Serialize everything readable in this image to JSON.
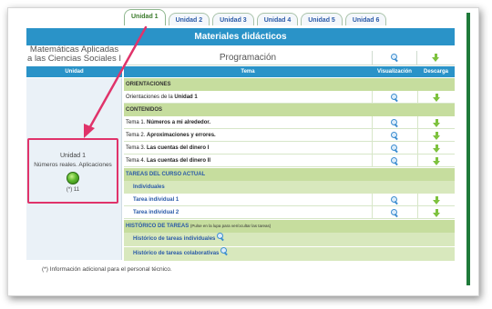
{
  "tabs": [
    "Unidad 1",
    "Unidad 2",
    "Unidad 3",
    "Unidad 4",
    "Unidad 5",
    "Unidad 6"
  ],
  "active_tab": "Unidad 1",
  "header": {
    "title": "Materiales didácticos"
  },
  "subject": {
    "line1": "Matemáticas Aplicadas",
    "line2": "a las Ciencias Sociales I"
  },
  "programacion": "Programación",
  "columns": {
    "unidad": "Unidad",
    "tema": "Tema",
    "visualizacion": "Visualización",
    "descarga": "Descarga"
  },
  "unit": {
    "title": "Unidad 1",
    "subtitle": "Números reales. Aplicaciones",
    "note": "(*) 11"
  },
  "sections": {
    "orientaciones": "ORIENTACIONES",
    "orientaciones_item_prefix": "Orientaciones de la ",
    "orientaciones_item_bold": "Unidad 1",
    "contenidos": "CONTENIDOS",
    "tema1_prefix": "Tema 1. ",
    "tema1_bold": "Números a mi alrededor.",
    "tema2_prefix": "Tema 2. ",
    "tema2_bold": "Aproximaciones y errores.",
    "tema3_prefix": "Tema 3. ",
    "tema3_bold": "Las cuentas del dinero I",
    "tema4_prefix": "Tema 4. ",
    "tema4_bold": "Las cuentas del dinero II",
    "tareas": "TAREAS DEL CURSO ACTUAL",
    "individuales": "Individuales",
    "tarea1": "Tarea individual 1",
    "tarea2": "Tarea individual 2",
    "historico": "HISTÓRICO DE TAREAS",
    "historico_hint": "(Pulse en la lupa para ver/ocultar las tareas)",
    "hist_ind": "Histórico de tareas individuales",
    "hist_col": "Histórico de tareas colaborativas"
  },
  "footnote": "(*) Información adicional para el personal técnico.",
  "colors": {
    "blue": "#2a93c8",
    "green_section": "#c6dd9e",
    "highlight": "#e0336a"
  },
  "icons": {
    "view": "magnifier-icon",
    "download": "download-arrow-icon"
  }
}
